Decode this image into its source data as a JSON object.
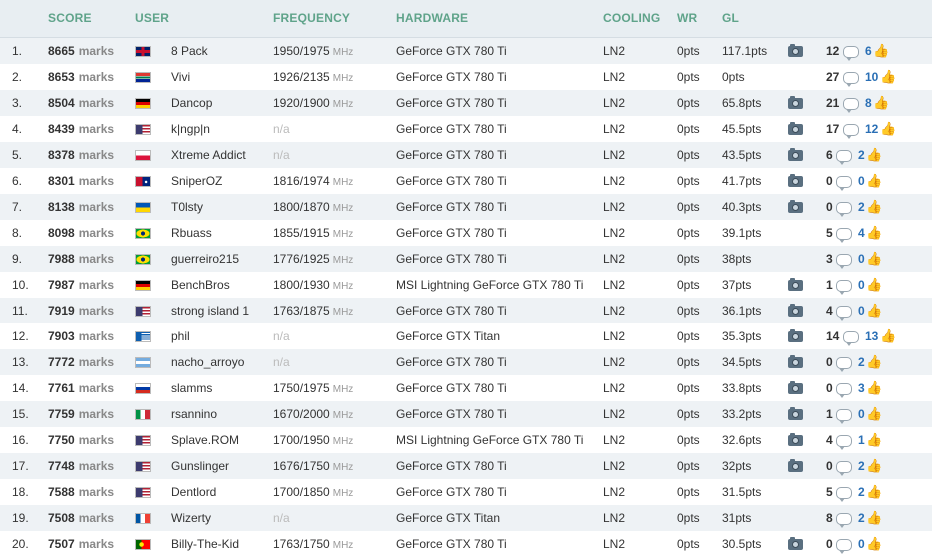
{
  "headers": {
    "score": "SCORE",
    "user": "USER",
    "frequency": "FREQUENCY",
    "hardware": "HARDWARE",
    "cooling": "COOLING",
    "wr": "WR",
    "gl": "GL"
  },
  "score_unit": "marks",
  "freq_unit": "MHz",
  "rows": [
    {
      "rank": "1.",
      "score": "8665",
      "flag": "gb",
      "user": "8 Pack",
      "freq": "1950/1975",
      "hw": "GeForce GTX 780 Ti",
      "cool": "LN2",
      "wr": "0pts",
      "gl": "117.1pts",
      "cam": true,
      "comments": "12",
      "likes": "6"
    },
    {
      "rank": "2.",
      "score": "8653",
      "flag": "za",
      "user": "Vivi",
      "freq": "1926/2135",
      "hw": "GeForce GTX 780 Ti",
      "cool": "LN2",
      "wr": "0pts",
      "gl": "0pts",
      "cam": false,
      "comments": "27",
      "likes": "10"
    },
    {
      "rank": "3.",
      "score": "8504",
      "flag": "de",
      "user": "Dancop",
      "freq": "1920/1900",
      "hw": "GeForce GTX 780 Ti",
      "cool": "LN2",
      "wr": "0pts",
      "gl": "65.8pts",
      "cam": true,
      "comments": "21",
      "likes": "8"
    },
    {
      "rank": "4.",
      "score": "8439",
      "flag": "us",
      "user": "k|ngp|n",
      "freq": "n/a",
      "hw": "GeForce GTX 780 Ti",
      "cool": "LN2",
      "wr": "0pts",
      "gl": "45.5pts",
      "cam": true,
      "comments": "17",
      "likes": "12"
    },
    {
      "rank": "5.",
      "score": "8378",
      "flag": "pl",
      "user": "Xtreme Addict",
      "freq": "n/a",
      "hw": "GeForce GTX 780 Ti",
      "cool": "LN2",
      "wr": "0pts",
      "gl": "43.5pts",
      "cam": true,
      "comments": "6",
      "likes": "2"
    },
    {
      "rank": "6.",
      "score": "8301",
      "flag": "au",
      "user": "SniperOZ",
      "freq": "1816/1974",
      "hw": "GeForce GTX 780 Ti",
      "cool": "LN2",
      "wr": "0pts",
      "gl": "41.7pts",
      "cam": true,
      "comments": "0",
      "likes": "0"
    },
    {
      "rank": "7.",
      "score": "8138",
      "flag": "ua",
      "user": "T0lsty",
      "freq": "1800/1870",
      "hw": "GeForce GTX 780 Ti",
      "cool": "LN2",
      "wr": "0pts",
      "gl": "40.3pts",
      "cam": true,
      "comments": "0",
      "likes": "2"
    },
    {
      "rank": "8.",
      "score": "8098",
      "flag": "br",
      "user": "Rbuass",
      "freq": "1855/1915",
      "hw": "GeForce GTX 780 Ti",
      "cool": "LN2",
      "wr": "0pts",
      "gl": "39.1pts",
      "cam": false,
      "comments": "5",
      "likes": "4"
    },
    {
      "rank": "9.",
      "score": "7988",
      "flag": "br",
      "user": "guerreiro215",
      "freq": "1776/1925",
      "hw": "GeForce GTX 780 Ti",
      "cool": "LN2",
      "wr": "0pts",
      "gl": "38pts",
      "cam": false,
      "comments": "3",
      "likes": "0"
    },
    {
      "rank": "10.",
      "score": "7987",
      "flag": "de",
      "user": "BenchBros",
      "freq": "1800/1930",
      "hw": "MSI Lightning GeForce GTX 780 Ti",
      "cool": "LN2",
      "wr": "0pts",
      "gl": "37pts",
      "cam": true,
      "comments": "1",
      "likes": "0"
    },
    {
      "rank": "11.",
      "score": "7919",
      "flag": "us",
      "user": "strong island 1",
      "freq": "1763/1875",
      "hw": "GeForce GTX 780 Ti",
      "cool": "LN2",
      "wr": "0pts",
      "gl": "36.1pts",
      "cam": true,
      "comments": "4",
      "likes": "0"
    },
    {
      "rank": "12.",
      "score": "7903",
      "flag": "gr",
      "user": "phil",
      "freq": "n/a",
      "hw": "GeForce GTX Titan",
      "cool": "LN2",
      "wr": "0pts",
      "gl": "35.3pts",
      "cam": true,
      "comments": "14",
      "likes": "13"
    },
    {
      "rank": "13.",
      "score": "7772",
      "flag": "ar",
      "user": "nacho_arroyo",
      "freq": "n/a",
      "hw": "GeForce GTX 780 Ti",
      "cool": "LN2",
      "wr": "0pts",
      "gl": "34.5pts",
      "cam": true,
      "comments": "0",
      "likes": "2"
    },
    {
      "rank": "14.",
      "score": "7761",
      "flag": "ru",
      "user": "slamms",
      "freq": "1750/1975",
      "hw": "GeForce GTX 780 Ti",
      "cool": "LN2",
      "wr": "0pts",
      "gl": "33.8pts",
      "cam": true,
      "comments": "0",
      "likes": "3"
    },
    {
      "rank": "15.",
      "score": "7759",
      "flag": "it",
      "user": "rsannino",
      "freq": "1670/2000",
      "hw": "GeForce GTX 780 Ti",
      "cool": "LN2",
      "wr": "0pts",
      "gl": "33.2pts",
      "cam": true,
      "comments": "1",
      "likes": "0"
    },
    {
      "rank": "16.",
      "score": "7750",
      "flag": "us",
      "user": "Splave.ROM",
      "freq": "1700/1950",
      "hw": "MSI Lightning GeForce GTX 780 Ti",
      "cool": "LN2",
      "wr": "0pts",
      "gl": "32.6pts",
      "cam": true,
      "comments": "4",
      "likes": "1"
    },
    {
      "rank": "17.",
      "score": "7748",
      "flag": "us",
      "user": "Gunslinger",
      "freq": "1676/1750",
      "hw": "GeForce GTX 780 Ti",
      "cool": "LN2",
      "wr": "0pts",
      "gl": "32pts",
      "cam": true,
      "comments": "0",
      "likes": "2"
    },
    {
      "rank": "18.",
      "score": "7588",
      "flag": "us",
      "user": "Dentlord",
      "freq": "1700/1850",
      "hw": "GeForce GTX 780 Ti",
      "cool": "LN2",
      "wr": "0pts",
      "gl": "31.5pts",
      "cam": false,
      "comments": "5",
      "likes": "2"
    },
    {
      "rank": "19.",
      "score": "7508",
      "flag": "fr",
      "user": "Wizerty",
      "freq": "n/a",
      "hw": "GeForce GTX Titan",
      "cool": "LN2",
      "wr": "0pts",
      "gl": "31pts",
      "cam": false,
      "comments": "8",
      "likes": "2"
    },
    {
      "rank": "20.",
      "score": "7507",
      "flag": "pt",
      "user": "Billy-The-Kid",
      "freq": "1763/1750",
      "hw": "GeForce GTX 780 Ti",
      "cool": "LN2",
      "wr": "0pts",
      "gl": "30.5pts",
      "cam": true,
      "comments": "0",
      "likes": "0"
    }
  ]
}
